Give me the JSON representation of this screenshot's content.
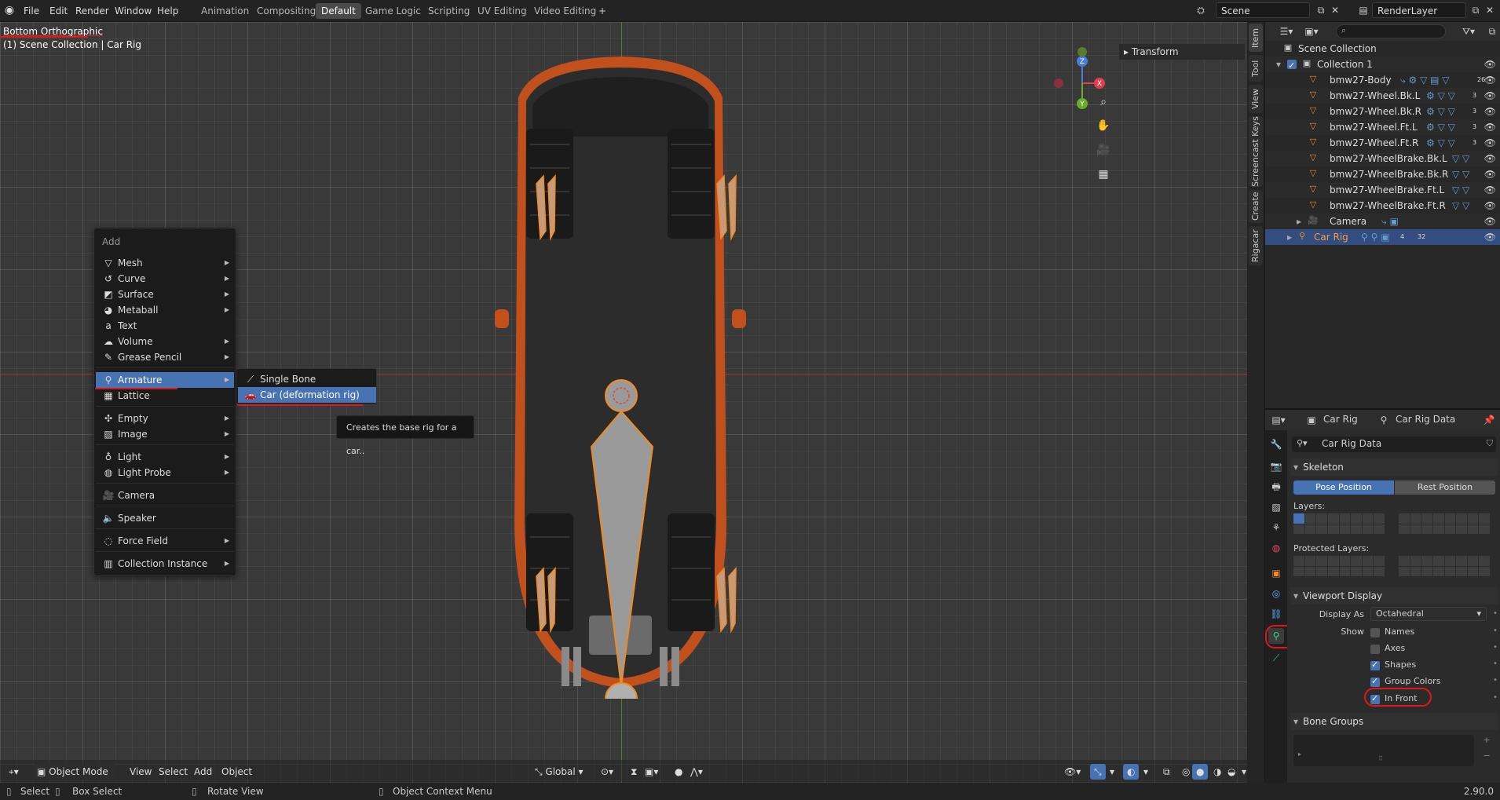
{
  "topbar": {
    "menus": [
      "File",
      "Edit",
      "Render",
      "Window",
      "Help"
    ],
    "workspaces": [
      "Animation",
      "Compositing",
      "Default",
      "Game Logic",
      "Scripting",
      "UV Editing",
      "Video Editing"
    ],
    "active_workspace": "Default",
    "add_workspace": "+",
    "scene": "Scene",
    "render_layer": "RenderLayer"
  },
  "viewport": {
    "view_name": "Bottom Orthographic",
    "collection_path": "(1) Scene Collection | Car Rig",
    "transform_panel": "Transform",
    "gizmo": {
      "z": "Z",
      "x": "X",
      "y": "Y"
    },
    "header": {
      "mode": "Object Mode",
      "menus": [
        "View",
        "Select",
        "Add",
        "Object"
      ],
      "orientation": "Global"
    }
  },
  "side_tabs": [
    "Item",
    "Tool",
    "View",
    "Screencast Keys",
    "Create",
    "Rigacar"
  ],
  "add_menu": {
    "title": "Add",
    "items": [
      {
        "label": "Mesh",
        "icon": "mesh-icon"
      },
      {
        "label": "Curve",
        "icon": "curve-icon"
      },
      {
        "label": "Surface",
        "icon": "surface-icon"
      },
      {
        "label": "Metaball",
        "icon": "metaball-icon"
      },
      {
        "label": "Text",
        "icon": "text-icon"
      },
      {
        "label": "Volume",
        "icon": "volume-icon"
      },
      {
        "label": "Grease Pencil",
        "icon": "grease-pencil-icon"
      },
      {
        "label": "Armature",
        "icon": "armature-icon"
      },
      {
        "label": "Lattice",
        "icon": "lattice-icon"
      },
      {
        "label": "Empty",
        "icon": "empty-icon"
      },
      {
        "label": "Image",
        "icon": "image-icon"
      },
      {
        "label": "Light",
        "icon": "light-icon"
      },
      {
        "label": "Light Probe",
        "icon": "light-probe-icon"
      },
      {
        "label": "Camera",
        "icon": "camera-icon"
      },
      {
        "label": "Speaker",
        "icon": "speaker-icon"
      },
      {
        "label": "Force Field",
        "icon": "force-field-icon"
      },
      {
        "label": "Collection Instance",
        "icon": "collection-instance-icon"
      }
    ],
    "submenu": [
      "Single Bone",
      "Car (deformation rig)"
    ],
    "tooltip": "Creates the base rig for a car.."
  },
  "outliner": {
    "root": "Scene Collection",
    "collection": "Collection 1",
    "objects": [
      {
        "name": "bmw27-Body",
        "badge": "26"
      },
      {
        "name": "bmw27-Wheel.Bk.L",
        "badge": "3"
      },
      {
        "name": "bmw27-Wheel.Bk.R",
        "badge": "3"
      },
      {
        "name": "bmw27-Wheel.Ft.L",
        "badge": "3"
      },
      {
        "name": "bmw27-Wheel.Ft.R",
        "badge": "3"
      },
      {
        "name": "bmw27-WheelBrake.Bk.L",
        "badge": ""
      },
      {
        "name": "bmw27-WheelBrake.Bk.R",
        "badge": ""
      },
      {
        "name": "bmw27-WheelBrake.Ft.L",
        "badge": ""
      },
      {
        "name": "bmw27-WheelBrake.Ft.R",
        "badge": ""
      },
      {
        "name": "Camera",
        "badge": ""
      }
    ],
    "selected": {
      "name": "Car Rig",
      "badge1": "4",
      "badge2": "32"
    }
  },
  "properties": {
    "object_name": "Car Rig",
    "data_name": "Car Rig Data",
    "datablock": "Car Rig Data",
    "skeleton": {
      "title": "Skeleton",
      "pose_position": "Pose Position",
      "rest_position": "Rest Position",
      "layers_label": "Layers:",
      "protected_label": "Protected Layers:"
    },
    "viewport_display": {
      "title": "Viewport Display",
      "display_as_label": "Display As",
      "display_as_value": "Octahedral",
      "show_label": "Show",
      "options": [
        {
          "label": "Names",
          "checked": false
        },
        {
          "label": "Axes",
          "checked": false
        },
        {
          "label": "Shapes",
          "checked": true
        },
        {
          "label": "Group Colors",
          "checked": true
        },
        {
          "label": "In Front",
          "checked": true
        }
      ]
    },
    "bone_groups": {
      "title": "Bone Groups"
    }
  },
  "statusbar": {
    "select": "Select",
    "box_select": "Box Select",
    "rotate": "Rotate View",
    "context_menu": "Object Context Menu",
    "version": "2.90.0"
  },
  "colors": {
    "accent": "#4772b3",
    "annotation": "#e01818",
    "car_body": "#c2501c",
    "bone": "#f08a24"
  }
}
